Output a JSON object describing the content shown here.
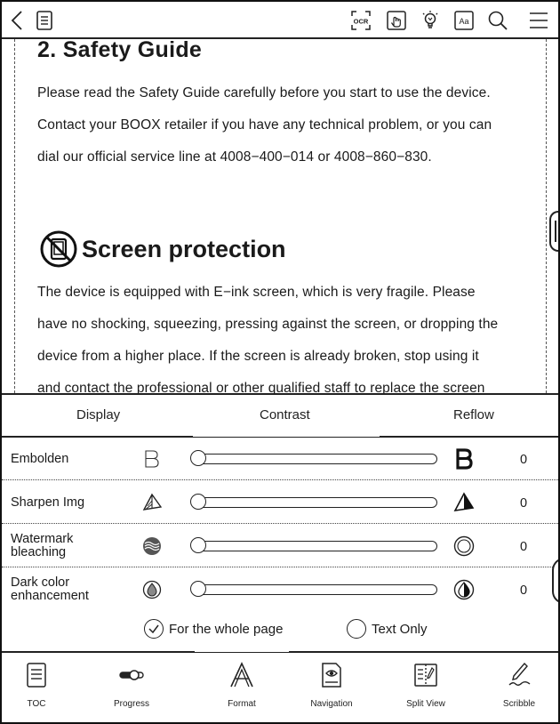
{
  "toolbar": {
    "icons": [
      "back-icon",
      "toc-doc-icon",
      "ocr-icon",
      "touch-icon",
      "light-icon",
      "font-icon",
      "search-icon",
      "menu-icon"
    ],
    "ocr_label": "OCR",
    "font_label": "Aa"
  },
  "document": {
    "heading": "2. Safety Guide",
    "paragraphs": [
      "Please read the Safety Guide carefully before you start to use the device.",
      "Contact your BOOX retailer if you have any technical problem, or you can",
      "dial our official service line at 4008−400−014 or 4008−860−830."
    ],
    "section_title": "Screen protection",
    "section_paragraphs": [
      "The device is equipped with E−ink screen, which is very fragile. Please",
      "have no shocking, squeezing, pressing against the screen, or dropping the",
      "device from a higher place. If the screen is already broken, stop using it",
      "and contact the professional or other qualified staff to replace the screen"
    ]
  },
  "panel": {
    "tabs": [
      "Display",
      "Contrast",
      "Reflow"
    ],
    "active_tab": "Contrast",
    "rows": [
      {
        "label": "Embolden",
        "value": "0",
        "level": 0,
        "icon_left": "embolden-light-icon",
        "icon_right": "embolden-bold-icon"
      },
      {
        "label": "Sharpen Img",
        "value": "0",
        "level": 0,
        "icon_left": "sharpen-light-icon",
        "icon_right": "sharpen-strong-icon"
      },
      {
        "label": "Watermark bleaching",
        "value": "0",
        "level": 0,
        "icon_left": "watermark-icon",
        "icon_right": "watermark-bleached-icon"
      },
      {
        "label": "Dark color enhancement",
        "value": "0",
        "level": 0,
        "icon_left": "dark-color-light-icon",
        "icon_right": "dark-color-strong-icon"
      }
    ],
    "options": [
      {
        "label": "For the whole page",
        "checked": true
      },
      {
        "label": "Text Only",
        "checked": false
      }
    ]
  },
  "bottom_nav": [
    {
      "label": "TOC",
      "icon": "toc-icon"
    },
    {
      "label": "Progress",
      "icon": "progress-icon"
    },
    {
      "label": "Format",
      "icon": "format-icon"
    },
    {
      "label": "Navigation",
      "icon": "navigation-icon"
    },
    {
      "label": "Split View",
      "icon": "split-view-icon"
    },
    {
      "label": "Scribble",
      "icon": "scribble-icon"
    }
  ],
  "colors": {
    "ink": "#1a1a1a",
    "background": "#ffffff"
  }
}
